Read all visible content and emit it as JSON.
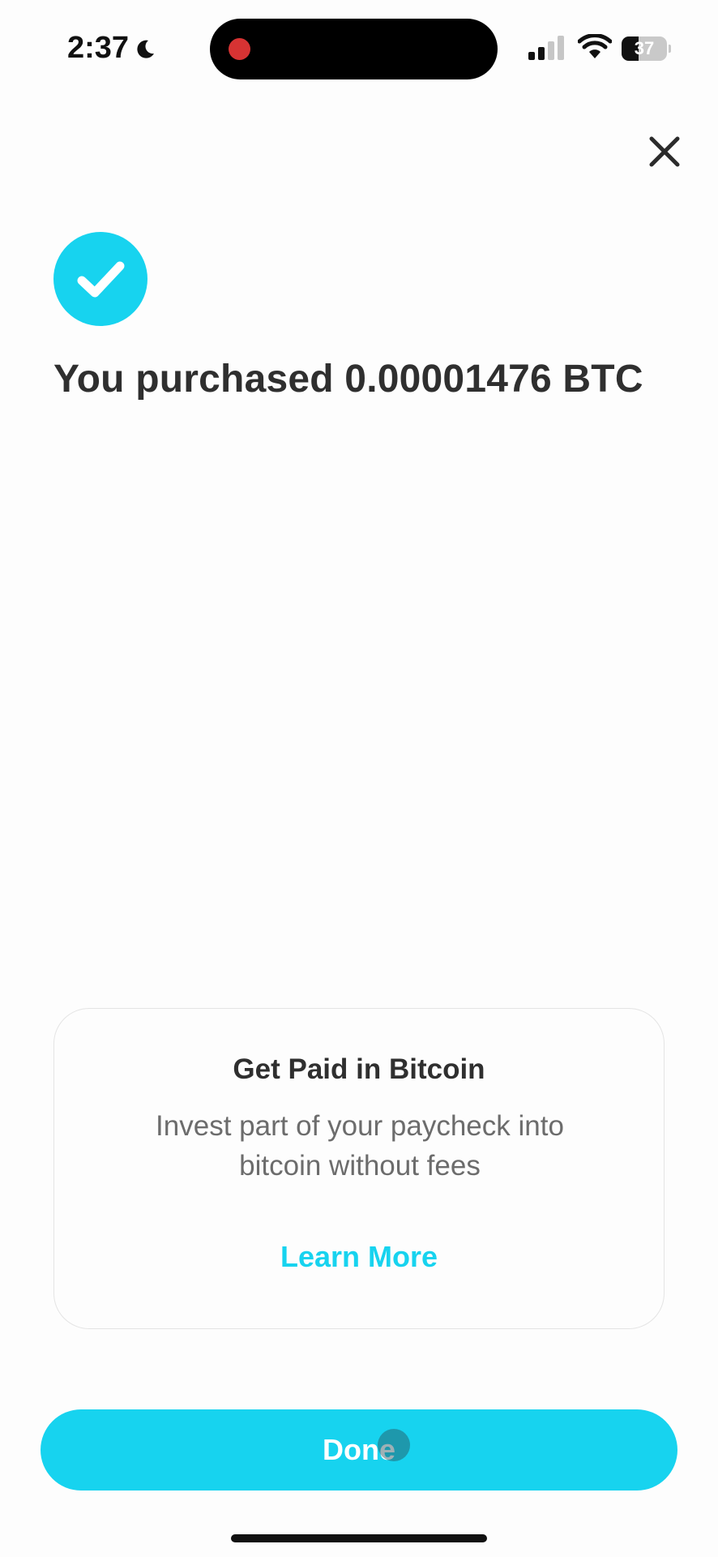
{
  "status_bar": {
    "time": "2:37",
    "battery_level": "37",
    "battery_fraction": 0.37,
    "icons": [
      "moon-icon",
      "signal-icon",
      "wifi-icon",
      "battery-icon"
    ]
  },
  "header": {
    "close_icon": "close-icon"
  },
  "confirmation": {
    "icon": "checkmark-icon",
    "title": "You purchased 0.00001476 BTC"
  },
  "promo": {
    "title": "Get Paid in Bitcoin",
    "body": "Invest part of your paycheck into bitcoin without fees",
    "link_label": "Learn More"
  },
  "footer": {
    "done_label": "Done"
  },
  "colors": {
    "accent": "#17d3ef",
    "text_primary": "#2f2f2f",
    "text_secondary": "#6c6c6c",
    "background": "#fdfdfd",
    "record_indicator": "#d73333"
  }
}
